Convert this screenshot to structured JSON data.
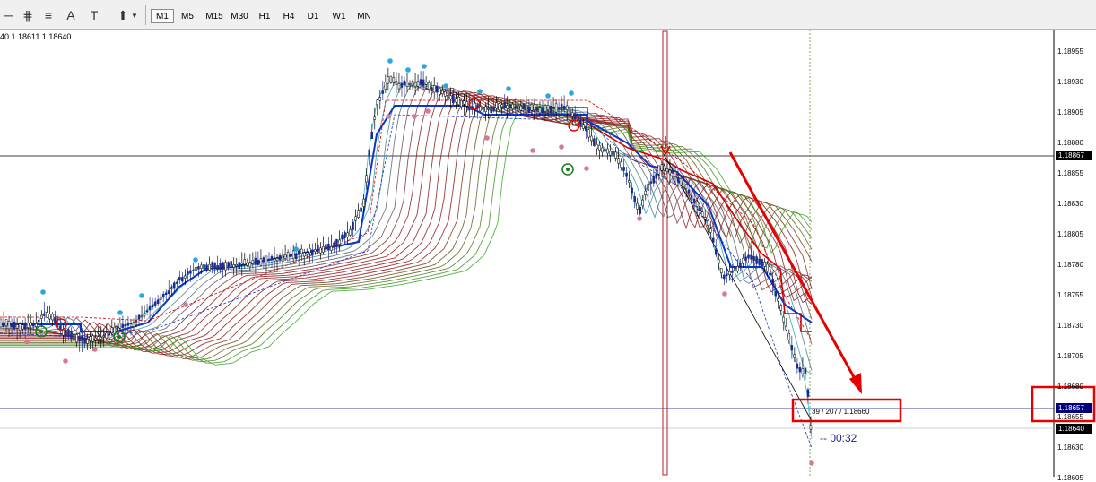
{
  "toolbar": {
    "drawing_tools": [
      {
        "name": "horizontal-line-tool-icon",
        "glyph": "─"
      },
      {
        "name": "equidistant-channel-tool-icon",
        "glyph": "⋕"
      },
      {
        "name": "fibonacci-tool-icon",
        "glyph": "≡"
      },
      {
        "name": "text-tool-icon",
        "glyph": "A"
      },
      {
        "name": "text-label-tool-icon",
        "glyph": "T"
      },
      {
        "name": "arrows-tool-icon",
        "glyph": "⬆"
      }
    ],
    "timeframes": [
      "M1",
      "M5",
      "M15",
      "M30",
      "H1",
      "H4",
      "D1",
      "W1",
      "MN"
    ],
    "active_timeframe": "M1"
  },
  "chart": {
    "symbol_info": "40 1.18611 1.18640",
    "price_axis": [
      "1.18955",
      "1.18930",
      "1.18905",
      "1.18880",
      "1.18855",
      "1.18830",
      "1.18805",
      "1.18780",
      "1.18755",
      "1.18730",
      "1.18705",
      "1.18680",
      "1.18655",
      "1.18630",
      "1.18605"
    ],
    "crosshair_price": "1.18867",
    "bid_price": "1.18657",
    "ask_price": "1.18640",
    "info_label": "39 / 207 / 1.18660",
    "timer": "--  00:32",
    "colors": {
      "bull": "#000000",
      "bear": "#1d2a8c",
      "ribbon_fast": "#1fb8cf",
      "ribbon_mid": "#8b1a1a",
      "ribbon_slow": "#22c022",
      "annotation": "#e60000",
      "signal_up": "#2aa7e0",
      "signal_down": "#d87a93",
      "bid_line": "#00007f"
    }
  }
}
